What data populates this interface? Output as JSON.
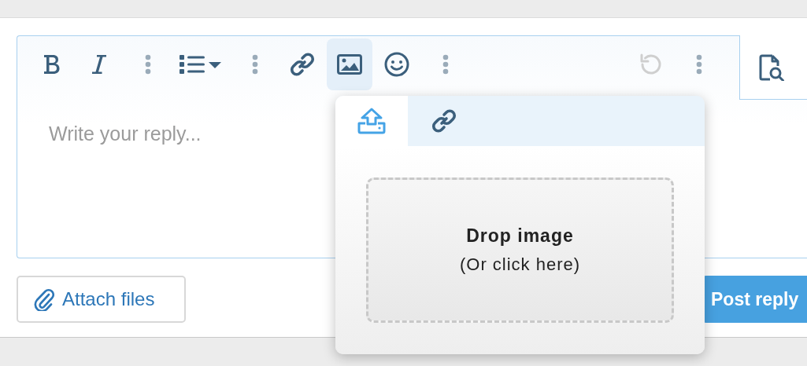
{
  "editor": {
    "toolbar": [
      {
        "kind": "bold",
        "selected": false,
        "disabled": false
      },
      {
        "kind": "italic",
        "selected": false,
        "disabled": false
      },
      {
        "kind": "more",
        "selected": false,
        "disabled": false
      },
      {
        "kind": "list",
        "selected": false,
        "disabled": false
      },
      {
        "kind": "more",
        "selected": false,
        "disabled": false
      },
      {
        "kind": "link",
        "selected": false,
        "disabled": false
      },
      {
        "kind": "image",
        "selected": true,
        "disabled": false
      },
      {
        "kind": "emoji",
        "selected": false,
        "disabled": false
      },
      {
        "kind": "more",
        "selected": false,
        "disabled": false
      },
      {
        "kind": "undo",
        "selected": false,
        "disabled": true
      },
      {
        "kind": "more",
        "selected": false,
        "disabled": false
      }
    ],
    "placeholder": "Write your reply..."
  },
  "image_popup": {
    "tabs": [
      {
        "kind": "upload",
        "selected": true
      },
      {
        "kind": "link",
        "selected": false
      }
    ],
    "drop_title": "Drop image",
    "drop_hint": "(Or click here)"
  },
  "buttons": {
    "attach": "Attach files",
    "post": "Post reply"
  }
}
